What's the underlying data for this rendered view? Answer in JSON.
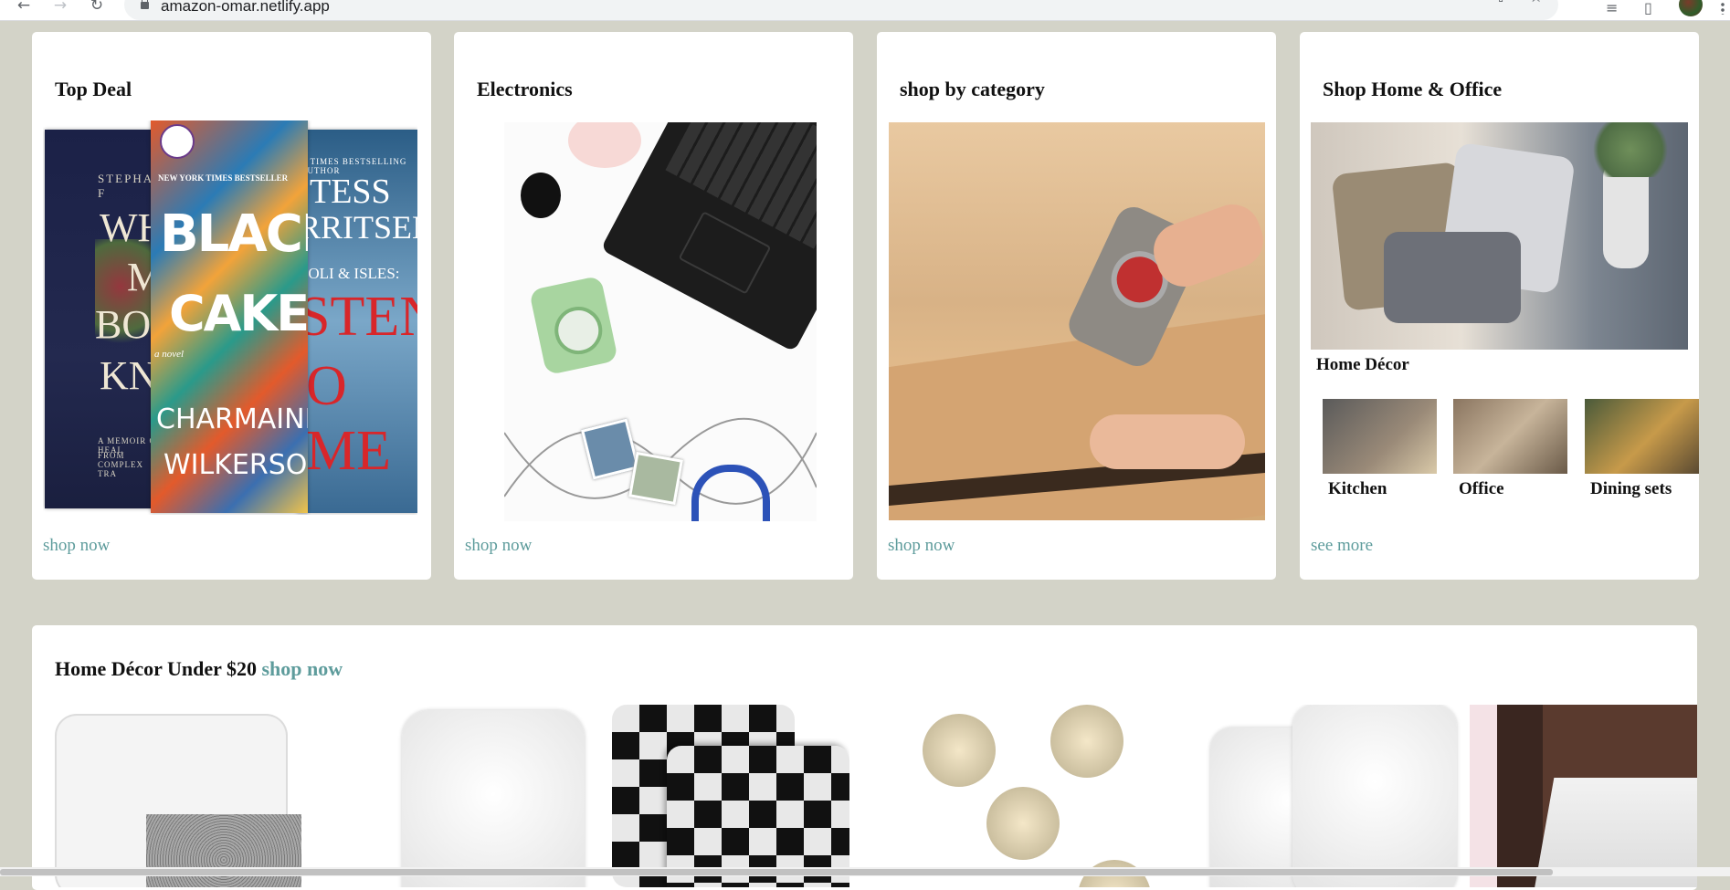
{
  "browser": {
    "url": "amazon-omar.netlify.app",
    "back_icon": "arrow-left-icon",
    "forward_icon": "arrow-right-icon",
    "reload_icon": "reload-icon"
  },
  "cards": [
    {
      "title": "Top Deal",
      "link": "shop now"
    },
    {
      "title": "Electronics",
      "link": "shop now"
    },
    {
      "title": "shop by category",
      "link": "shop now"
    },
    {
      "title": "Shop Home & Office",
      "link": "see more"
    }
  ],
  "home_office": {
    "main_label": "Home Décor",
    "items": [
      "Kitchen",
      "Office",
      "Dining sets"
    ]
  },
  "books": {
    "left_lines": [
      "STEPHANIE F",
      "WHAT",
      "MY",
      "BONE",
      "KNOW",
      "A MEMOIR OF HEAL",
      "FROM COMPLEX TRA"
    ],
    "center_lines": [
      "NEW YORK TIMES BESTSELLER",
      "BLACK",
      "CAKE",
      "a novel",
      "CHARMAINE",
      "WILKERSON"
    ],
    "right_lines": [
      "K TIMES BESTSELLING AUTHOR",
      "TESS",
      "RRITSEN",
      "ZOLI & ISLES:",
      "STEN",
      "O ME"
    ]
  },
  "band": {
    "title": "Home Décor Under $20",
    "link": "shop now"
  },
  "colors": {
    "page_bg": "#d3d3c8",
    "card_bg": "#ffffff",
    "link": "#5e9c9c"
  }
}
